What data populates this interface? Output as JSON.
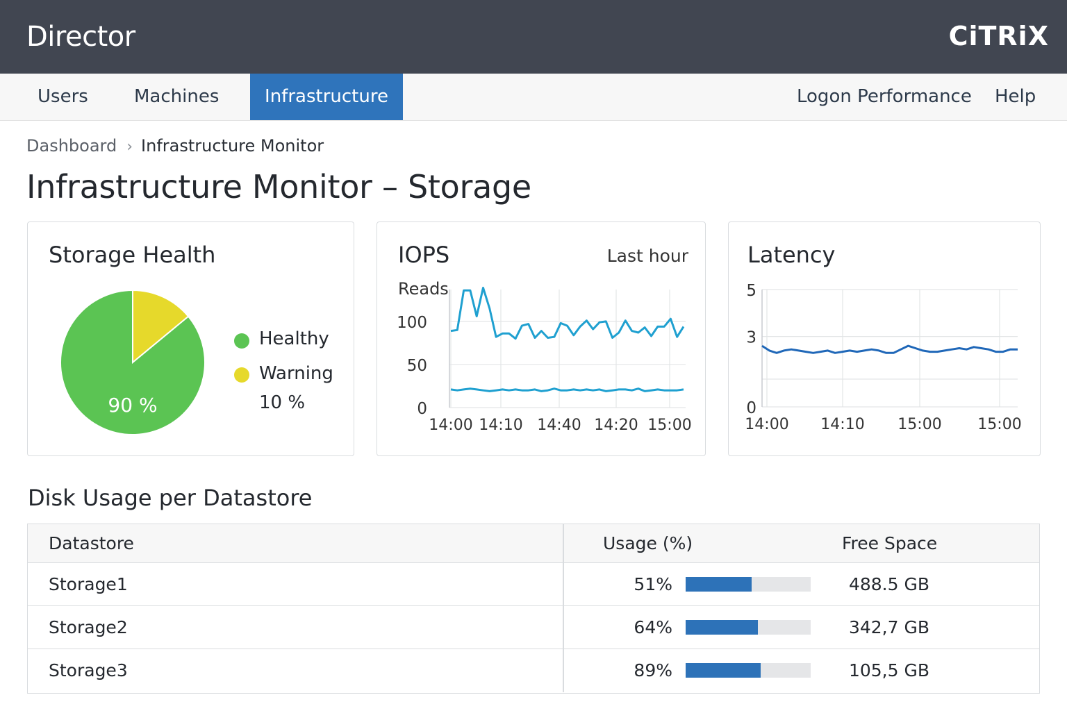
{
  "header": {
    "app_title": "Director",
    "brand": "CiTRiX"
  },
  "nav": {
    "left": [
      {
        "label": "Users",
        "active": false
      },
      {
        "label": "Machines",
        "active": false
      },
      {
        "label": "Infrastructure",
        "active": true
      }
    ],
    "right": [
      {
        "label": "Logon Performance"
      },
      {
        "label": "Help"
      }
    ]
  },
  "breadcrumb": {
    "parent": "Dashboard",
    "separator": "›",
    "current": "Infrastructure Monitor"
  },
  "page_title": "Infrastructure Monitor – Storage",
  "colors": {
    "header_bg": "#414651",
    "accent": "#2f74bb",
    "healthy": "#5bc453",
    "warning": "#e6d92b",
    "iops_line": "#1fa0d0",
    "latency_line": "#1f67b8",
    "bar": "#2d72b8"
  },
  "storage_health": {
    "title": "Storage Health",
    "healthy_label": "Healthy",
    "warning_label": "Warning",
    "healthy_value": "90 %",
    "warning_value": "10 %"
  },
  "iops": {
    "title": "IOPS",
    "range": "Last hour",
    "series_label": "Reads"
  },
  "latency": {
    "title": "Latency"
  },
  "chart_data": [
    {
      "type": "pie",
      "title": "Storage Health",
      "categories": [
        "Healthy",
        "Warning"
      ],
      "values": [
        86,
        14
      ],
      "data_labels": [
        "90 %",
        "10 %"
      ],
      "colors": [
        "#5bc453",
        "#e6d92b"
      ]
    },
    {
      "type": "line",
      "title": "IOPS",
      "subtitle": "Last hour",
      "ylabel": "Reads",
      "x_ticks": [
        "14:00",
        "14:10",
        "14:40",
        "14:20",
        "15:00"
      ],
      "y_ticks": [
        0,
        50,
        100
      ],
      "ylim": [
        0,
        137
      ],
      "grid": true,
      "series": [
        {
          "values": [
            89,
            90,
            136,
            136,
            106,
            139,
            115,
            82,
            86,
            86,
            80,
            95,
            97,
            81,
            89,
            81,
            82,
            98,
            95,
            84,
            94,
            101,
            91,
            99,
            100,
            81,
            87,
            101,
            89,
            87,
            93,
            83,
            94,
            94,
            103,
            82,
            94
          ]
        },
        {
          "values": [
            21,
            20,
            21,
            22,
            21,
            20,
            19,
            20,
            21,
            20,
            21,
            20,
            20,
            21,
            19,
            20,
            22,
            20,
            20,
            21,
            20,
            21,
            20,
            21,
            19,
            20,
            21,
            21,
            20,
            22,
            19,
            20,
            21,
            20,
            20,
            20,
            21
          ]
        }
      ]
    },
    {
      "type": "line",
      "title": "Latency",
      "x_ticks": [
        "14:00",
        "14:10",
        "15:00",
        "15:00"
      ],
      "y_ticks": [
        0,
        3,
        5
      ],
      "ylim": [
        0,
        5
      ],
      "grid": true,
      "series": [
        {
          "values": [
            2.6,
            2.4,
            2.3,
            2.4,
            2.45,
            2.4,
            2.35,
            2.3,
            2.35,
            2.4,
            2.3,
            2.35,
            2.4,
            2.35,
            2.4,
            2.45,
            2.4,
            2.3,
            2.3,
            2.45,
            2.6,
            2.5,
            2.4,
            2.35,
            2.35,
            2.4,
            2.45,
            2.5,
            2.45,
            2.55,
            2.5,
            2.45,
            2.35,
            2.35,
            2.45,
            2.45
          ]
        }
      ]
    }
  ],
  "disk_usage": {
    "title": "Disk Usage per Datastore",
    "columns": [
      "Datastore",
      "Usage (%)",
      "Free Space"
    ],
    "rows": [
      {
        "name": "Storage1",
        "usage": "51%",
        "usage_fraction": 0.53,
        "free": "488.5 GB"
      },
      {
        "name": "Storage2",
        "usage": "64%",
        "usage_fraction": 0.58,
        "free": "342,7 GB"
      },
      {
        "name": "Storage3",
        "usage": "89%",
        "usage_fraction": 0.6,
        "free": "105,5 GB"
      }
    ]
  }
}
